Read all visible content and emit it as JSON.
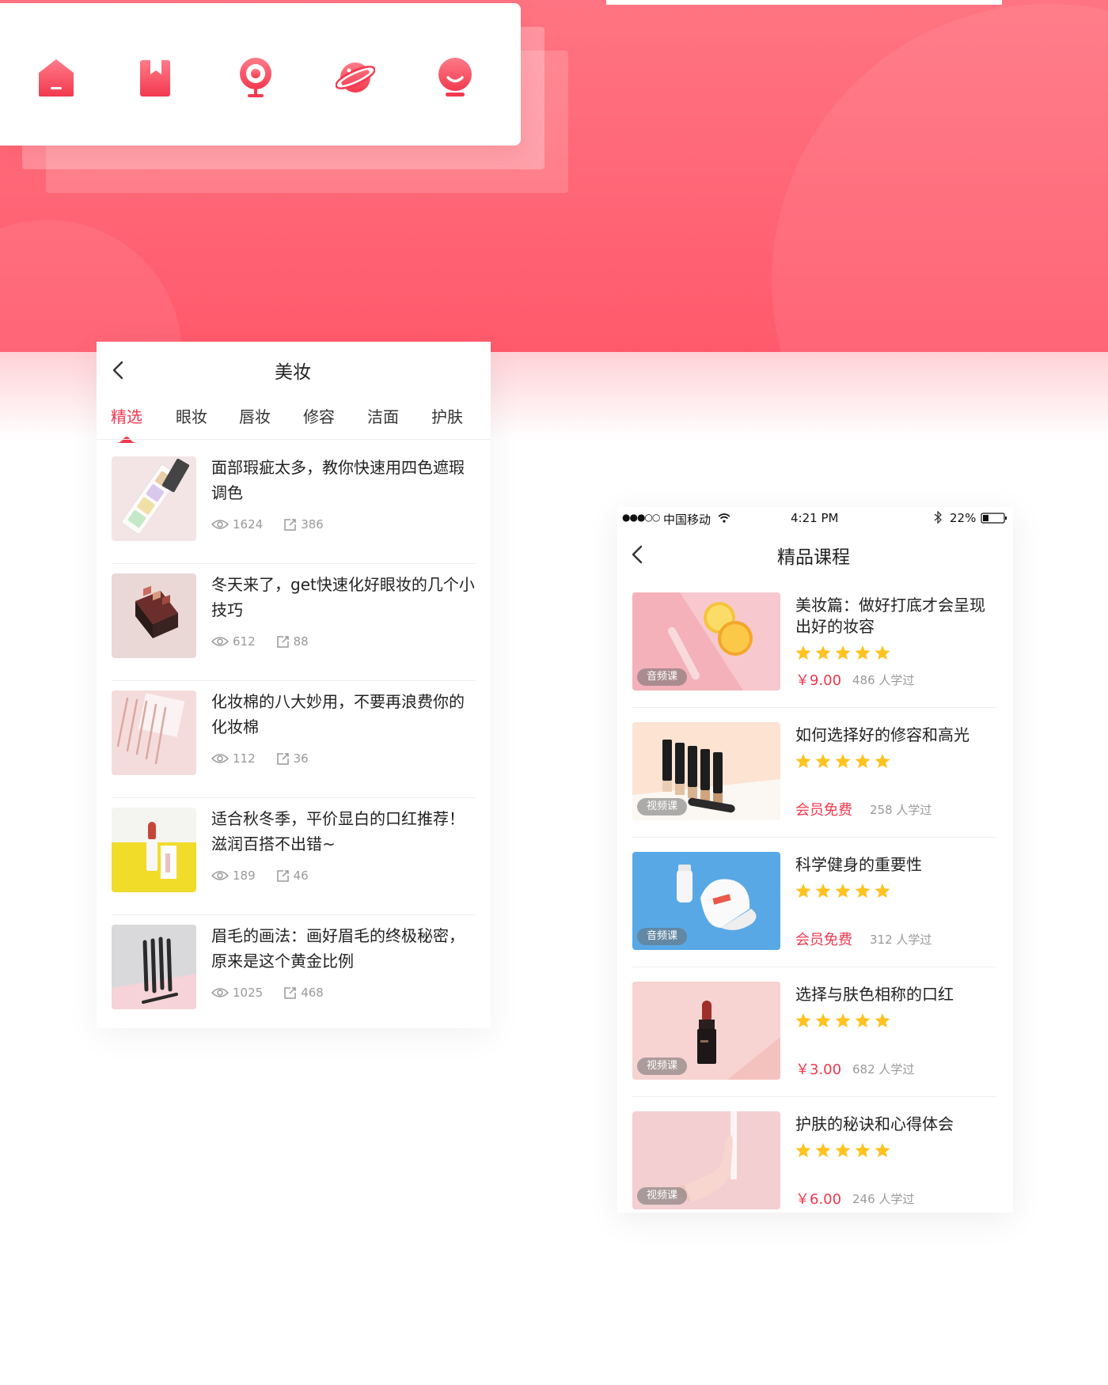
{
  "hero": {
    "icons": [
      "home-icon",
      "bookmark-icon",
      "webcam-icon",
      "planet-icon",
      "smiley-icon"
    ],
    "accent_color": "#ff5a6c"
  },
  "phone1": {
    "title": "美妆",
    "tabs": [
      "精选",
      "眼妆",
      "唇妆",
      "修容",
      "洁面",
      "护肤"
    ],
    "active_tab": "精选",
    "articles": [
      {
        "title": "面部瑕疵太多，教你快速用四色遮瑕调色",
        "views": "1624",
        "shares": "386"
      },
      {
        "title": "冬天来了，get快速化好眼妆的几个小技巧",
        "views": "612",
        "shares": "88"
      },
      {
        "title": "化妆棉的八大妙用，不要再浪费你的化妆棉",
        "views": "112",
        "shares": "36"
      },
      {
        "title": "适合秋冬季，平价显白的口红推荐！滋润百搭不出错~",
        "views": "189",
        "shares": "46"
      },
      {
        "title": "眉毛的画法：画好眉毛的终极秘密，原来是这个黄金比例",
        "views": "1025",
        "shares": "468"
      }
    ]
  },
  "phone2": {
    "status": {
      "signal": "●●●○○",
      "carrier": "中国移动",
      "time": "4:21 PM",
      "battery": "22%"
    },
    "title": "精品课程",
    "courses": [
      {
        "title": "美妆篇：做好打底才会呈现出好的妆容",
        "badge": "音频课",
        "price": "￥9.00",
        "learners": "486 人学过",
        "rating": 5
      },
      {
        "title": "如何选择好的修容和高光",
        "badge": "视频课",
        "price": "会员免费",
        "learners": "258 人学过",
        "rating": 5
      },
      {
        "title": "科学健身的重要性",
        "badge": "音频课",
        "price": "会员免费",
        "learners": "312 人学过",
        "rating": 5
      },
      {
        "title": "选择与肤色相称的口红",
        "badge": "视频课",
        "price": "￥3.00",
        "learners": "682 人学过",
        "rating": 5
      },
      {
        "title": "护肤的秘诀和心得体会",
        "badge": "视频课",
        "price": "￥6.00",
        "learners": "246 人学过",
        "rating": 5
      }
    ]
  }
}
